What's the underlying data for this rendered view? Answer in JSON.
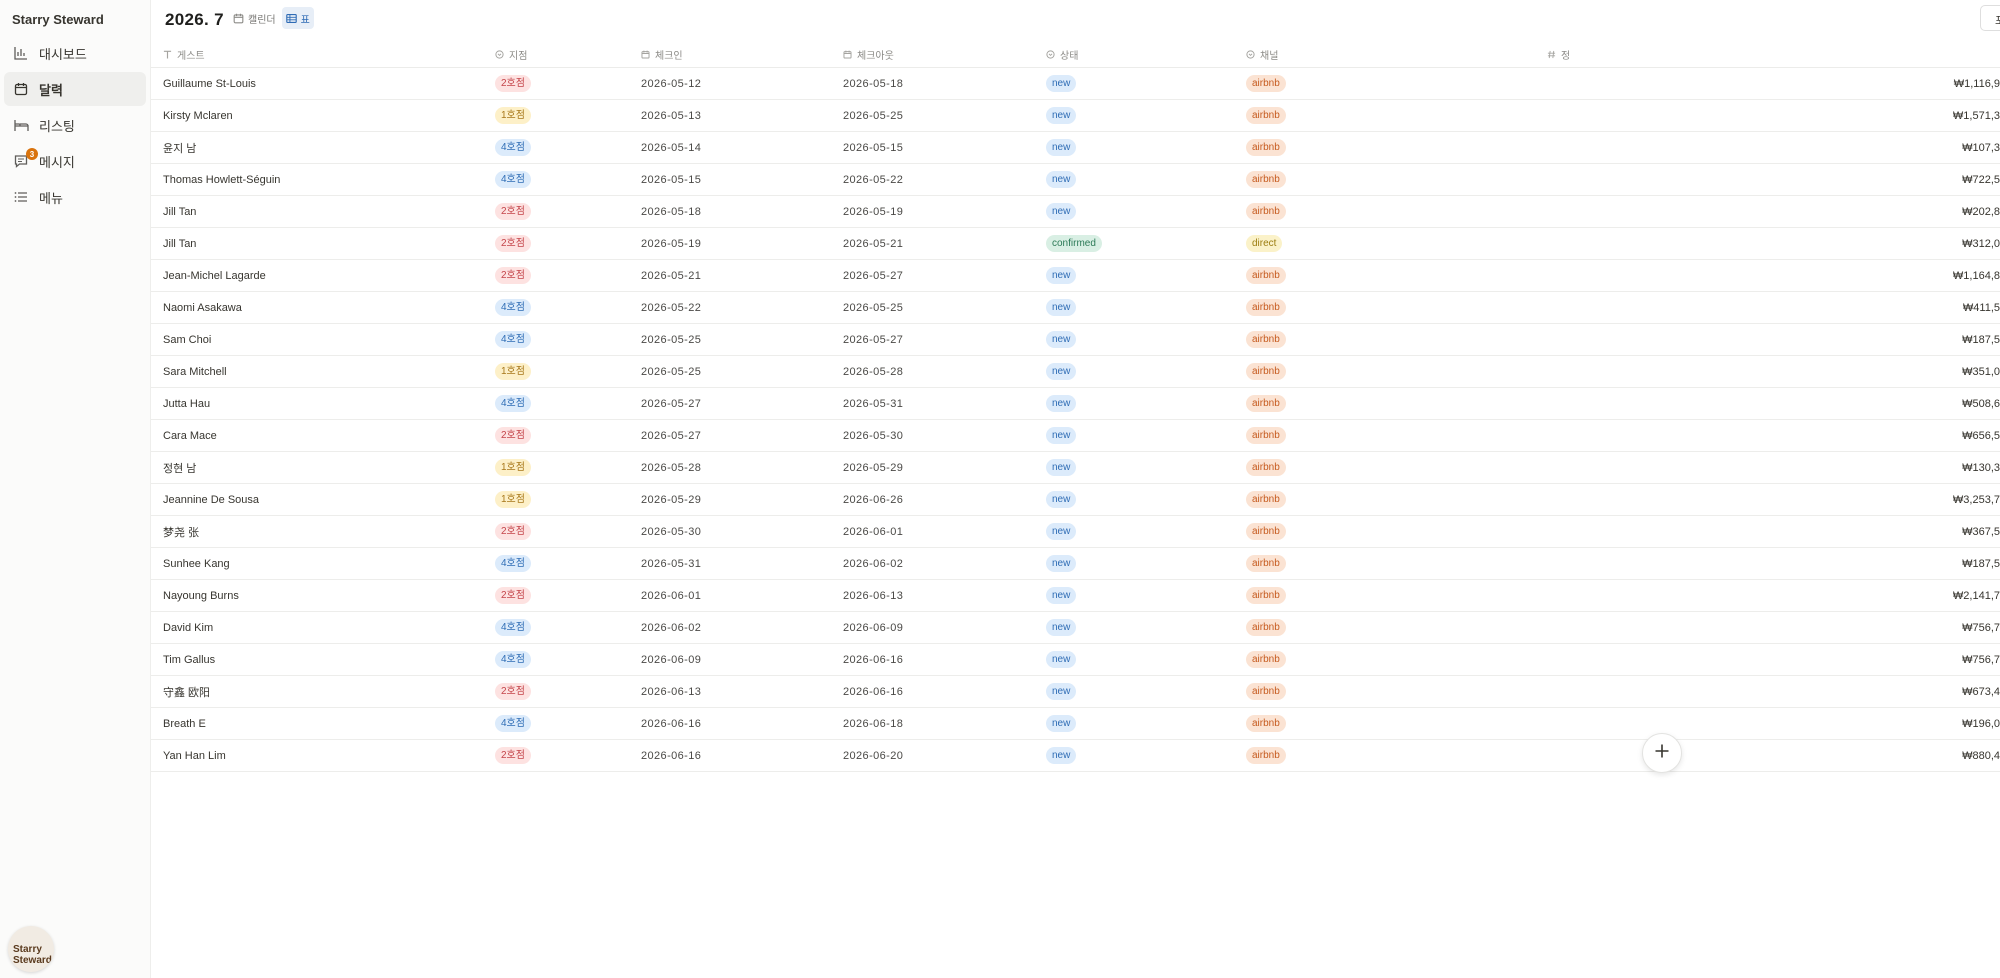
{
  "app": {
    "brand": "Starry Steward"
  },
  "sidebar": {
    "items": [
      {
        "label": "대시보드",
        "icon": "bar-chart-icon",
        "active": false
      },
      {
        "label": "달력",
        "icon": "calendar-icon",
        "active": true
      },
      {
        "label": "리스팅",
        "icon": "bed-icon",
        "active": false
      },
      {
        "label": "메시지",
        "icon": "message-icon",
        "active": false,
        "badge": "3"
      },
      {
        "label": "메뉴",
        "icon": "list-icon",
        "active": false
      }
    ],
    "avatar_line1": "Starry",
    "avatar_line2": "Steward"
  },
  "header": {
    "period": "2026. 7",
    "views": [
      {
        "label": "캘린더",
        "icon": "calendar-icon",
        "active": false
      },
      {
        "label": "표",
        "icon": "table-icon",
        "active": true
      }
    ],
    "right_button": "포"
  },
  "table": {
    "columns": [
      {
        "label": "게스트",
        "icon": "text-type-icon"
      },
      {
        "label": "지점",
        "icon": "select-icon"
      },
      {
        "label": "체크인",
        "icon": "calendar-icon"
      },
      {
        "label": "체크아웃",
        "icon": "calendar-icon"
      },
      {
        "label": "상태",
        "icon": "select-icon"
      },
      {
        "label": "채널",
        "icon": "select-icon"
      },
      {
        "label": "정",
        "icon": "hash-icon"
      }
    ],
    "rows": [
      {
        "guest": "Guillaume St-Louis",
        "branch": "2호점",
        "checkin": "2026-05-12",
        "checkout": "2026-05-18",
        "status": "new",
        "channel": "airbnb",
        "amount": "₩1,116,9"
      },
      {
        "guest": "Kirsty Mclaren",
        "branch": "1호점",
        "checkin": "2026-05-13",
        "checkout": "2026-05-25",
        "status": "new",
        "channel": "airbnb",
        "amount": "₩1,571,3"
      },
      {
        "guest": "윤지 남",
        "branch": "4호점",
        "checkin": "2026-05-14",
        "checkout": "2026-05-15",
        "status": "new",
        "channel": "airbnb",
        "amount": "₩107,3"
      },
      {
        "guest": "Thomas Howlett-Séguin",
        "branch": "4호점",
        "checkin": "2026-05-15",
        "checkout": "2026-05-22",
        "status": "new",
        "channel": "airbnb",
        "amount": "₩722,5"
      },
      {
        "guest": "Jill Tan",
        "branch": "2호점",
        "checkin": "2026-05-18",
        "checkout": "2026-05-19",
        "status": "new",
        "channel": "airbnb",
        "amount": "₩202,8"
      },
      {
        "guest": "Jill Tan",
        "branch": "2호점",
        "checkin": "2026-05-19",
        "checkout": "2026-05-21",
        "status": "confirmed",
        "channel": "direct",
        "amount": "₩312,0"
      },
      {
        "guest": "Jean-Michel Lagarde",
        "branch": "2호점",
        "checkin": "2026-05-21",
        "checkout": "2026-05-27",
        "status": "new",
        "channel": "airbnb",
        "amount": "₩1,164,8"
      },
      {
        "guest": "Naomi Asakawa",
        "branch": "4호점",
        "checkin": "2026-05-22",
        "checkout": "2026-05-25",
        "status": "new",
        "channel": "airbnb",
        "amount": "₩411,5"
      },
      {
        "guest": "Sam Choi",
        "branch": "4호점",
        "checkin": "2026-05-25",
        "checkout": "2026-05-27",
        "status": "new",
        "channel": "airbnb",
        "amount": "₩187,5"
      },
      {
        "guest": "Sara Mitchell",
        "branch": "1호점",
        "checkin": "2026-05-25",
        "checkout": "2026-05-28",
        "status": "new",
        "channel": "airbnb",
        "amount": "₩351,0"
      },
      {
        "guest": "Jutta Hau",
        "branch": "4호점",
        "checkin": "2026-05-27",
        "checkout": "2026-05-31",
        "status": "new",
        "channel": "airbnb",
        "amount": "₩508,6"
      },
      {
        "guest": "Cara Mace",
        "branch": "2호점",
        "checkin": "2026-05-27",
        "checkout": "2026-05-30",
        "status": "new",
        "channel": "airbnb",
        "amount": "₩656,5"
      },
      {
        "guest": "정현 남",
        "branch": "1호점",
        "checkin": "2026-05-28",
        "checkout": "2026-05-29",
        "status": "new",
        "channel": "airbnb",
        "amount": "₩130,3"
      },
      {
        "guest": "Jeannine De Sousa",
        "branch": "1호점",
        "checkin": "2026-05-29",
        "checkout": "2026-06-26",
        "status": "new",
        "channel": "airbnb",
        "amount": "₩3,253,7"
      },
      {
        "guest": "梦尧 张",
        "branch": "2호점",
        "checkin": "2026-05-30",
        "checkout": "2026-06-01",
        "status": "new",
        "channel": "airbnb",
        "amount": "₩367,5"
      },
      {
        "guest": "Sunhee Kang",
        "branch": "4호점",
        "checkin": "2026-05-31",
        "checkout": "2026-06-02",
        "status": "new",
        "channel": "airbnb",
        "amount": "₩187,5"
      },
      {
        "guest": "Nayoung Burns",
        "branch": "2호점",
        "checkin": "2026-06-01",
        "checkout": "2026-06-13",
        "status": "new",
        "channel": "airbnb",
        "amount": "₩2,141,7"
      },
      {
        "guest": "David Kim",
        "branch": "4호점",
        "checkin": "2026-06-02",
        "checkout": "2026-06-09",
        "status": "new",
        "channel": "airbnb",
        "amount": "₩756,7"
      },
      {
        "guest": "Tim Gallus",
        "branch": "4호점",
        "checkin": "2026-06-09",
        "checkout": "2026-06-16",
        "status": "new",
        "channel": "airbnb",
        "amount": "₩756,7"
      },
      {
        "guest": "守鑫 欧阳",
        "branch": "2호점",
        "checkin": "2026-06-13",
        "checkout": "2026-06-16",
        "status": "new",
        "channel": "airbnb",
        "amount": "₩673,4"
      },
      {
        "guest": "Breath E",
        "branch": "4호점",
        "checkin": "2026-06-16",
        "checkout": "2026-06-18",
        "status": "new",
        "channel": "airbnb",
        "amount": "₩196,0"
      },
      {
        "guest": "Yan Han Lim",
        "branch": "2호점",
        "checkin": "2026-06-16",
        "checkout": "2026-06-20",
        "status": "new",
        "channel": "airbnb",
        "amount": "₩880,4"
      }
    ]
  },
  "fab": {
    "icon": "plus-icon"
  },
  "colors": {
    "sidebar_bg": "#fbfbfa",
    "active_nav": "#efefed",
    "badge": "#d9730d",
    "branch_2": "#fde2e1",
    "branch_1": "#fdf0c8",
    "branch_4": "#dcebfb",
    "status_new": "#dcebfb",
    "status_confirmed": "#d9efe4",
    "channel_airbnb": "#fbe3d3",
    "channel_direct": "#fbf2c9"
  }
}
